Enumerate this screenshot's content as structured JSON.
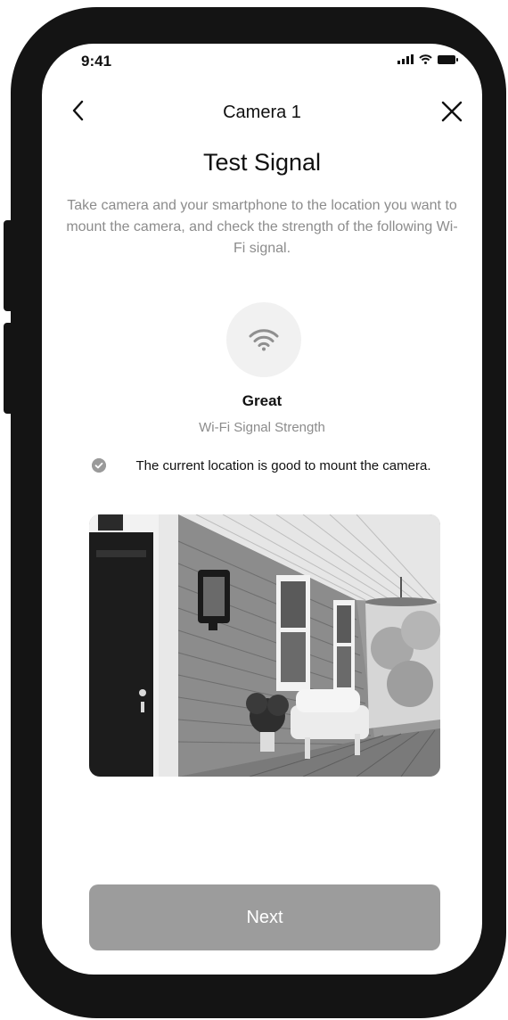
{
  "status_bar": {
    "time": "9:41"
  },
  "nav": {
    "title": "Camera 1"
  },
  "page": {
    "title": "Test Signal",
    "description": "Take camera and your smartphone to the location you want to mount the camera, and check the strength of the following Wi-Fi signal."
  },
  "signal": {
    "strength": "Great",
    "label": "Wi-Fi Signal Strength"
  },
  "check": {
    "message": "The current location is good to mount the camera."
  },
  "icons": [
    "back-chevron-icon",
    "close-icon",
    "wifi-icon",
    "check-circle-icon",
    "cellular-signal-icon",
    "battery-icon"
  ],
  "colors": {
    "button": "#9c9c9c",
    "muted_text": "#8c8c8c",
    "frame": "#141414"
  },
  "next_button": {
    "label": "Next"
  }
}
